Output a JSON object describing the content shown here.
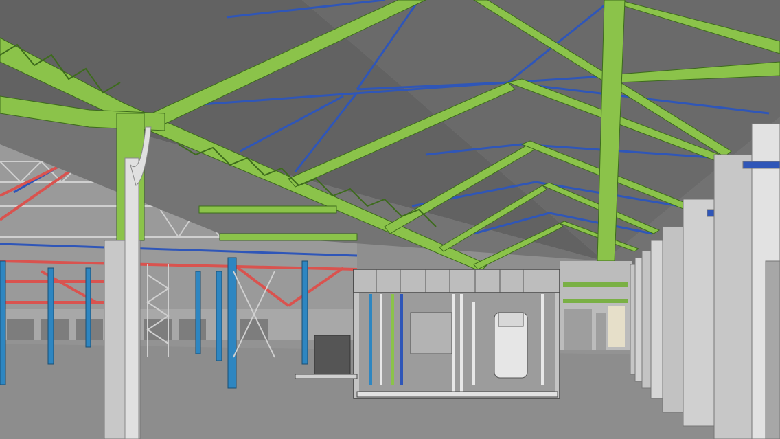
{
  "scene": {
    "type": "3d-bim-model-view",
    "palette": {
      "roof_panel": "#6b6b6b",
      "roof_panel_dark": "#5e5e5e",
      "floor": "#8e8e8e",
      "primary_truss": "#8bc34a",
      "primary_truss_edge": "#3d6b1c",
      "secondary_bracing": "#2f56b8",
      "red_bracing": "#d9534f",
      "column_blue": "#2e86c1",
      "wall_grey": "#b5b5b5",
      "downpipe": "#d8d8d8",
      "equipment_room": "#cfcfcf"
    },
    "elements": [
      "roof-panels",
      "main-green-trusses",
      "blue-roof-bracing",
      "background-hall-with-red-and-blue-steel",
      "downpipe-column",
      "equipment-room-enclosure",
      "right-wall-pilasters",
      "end-gable-wall"
    ]
  }
}
